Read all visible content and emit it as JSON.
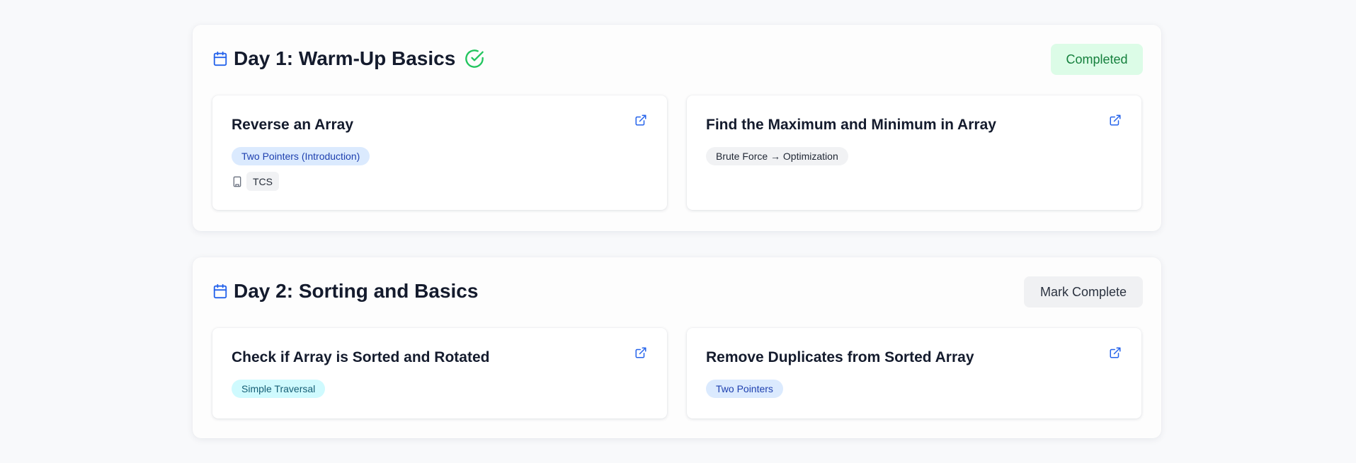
{
  "days": [
    {
      "title": "Day 1: Warm-Up Basics",
      "status_label": "Completed",
      "completed": true,
      "problems": [
        {
          "title": "Reverse an Array",
          "tag": "Two Pointers (Introduction)",
          "company": "TCS"
        },
        {
          "title": "Find the Maximum and Minimum in Array",
          "tag": "Brute Force → Optimization"
        }
      ]
    },
    {
      "title": "Day 2: Sorting and Basics",
      "status_label": "Mark Complete",
      "completed": false,
      "problems": [
        {
          "title": "Check if Array is Sorted and Rotated",
          "tag": "Simple Traversal"
        },
        {
          "title": "Remove Duplicates from Sorted Array",
          "tag": "Two Pointers"
        }
      ]
    }
  ],
  "icons": {
    "day_header": "calendar-icon",
    "completed_mark": "check-circle-icon",
    "problem_link": "external-link-icon",
    "company": "building-icon"
  },
  "colors": {
    "accent_blue": "#2563eb",
    "success_green": "#22c55e",
    "completed_bg": "#dcfce7",
    "completed_text": "#15803d"
  }
}
